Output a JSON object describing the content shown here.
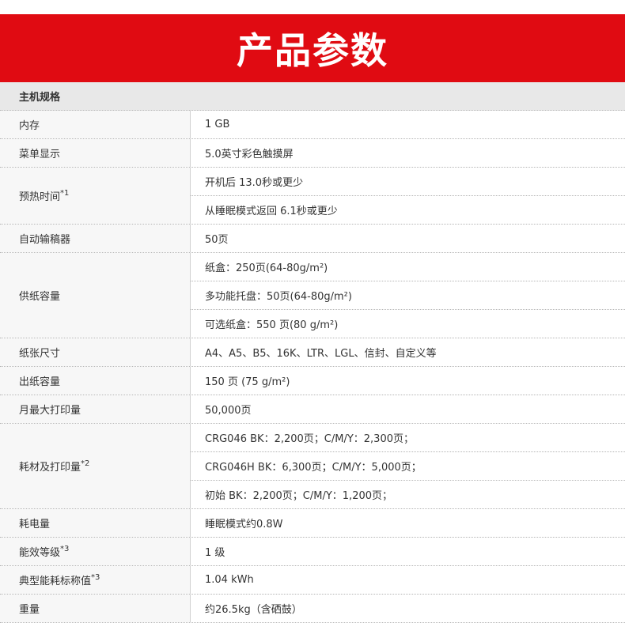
{
  "banner": {
    "title": "产品参数"
  },
  "section": {
    "title": "主机规格"
  },
  "rows": [
    {
      "label": "内存",
      "sup": "",
      "values": [
        "1 GB"
      ]
    },
    {
      "label": "菜单显示",
      "sup": "",
      "values": [
        "5.0英寸彩色触摸屏"
      ]
    },
    {
      "label": "预热时间",
      "sup": "*1",
      "values": [
        "开机后 13.0秒或更少",
        "从睡眠模式返回 6.1秒或更少"
      ]
    },
    {
      "label": "自动输稿器",
      "sup": "",
      "values": [
        "50页"
      ]
    },
    {
      "label": "供纸容量",
      "sup": "",
      "values": [
        "纸盒：250页(64-80g/m²)",
        "多功能托盘：50页(64-80g/m²)",
        "可选纸盒：550 页(80 g/m²)"
      ]
    },
    {
      "label": "纸张尺寸",
      "sup": "",
      "values": [
        "A4、A5、B5、16K、LTR、LGL、信封、自定义等"
      ]
    },
    {
      "label": "出纸容量",
      "sup": "",
      "values": [
        "150 页 (75 g/m²)"
      ]
    },
    {
      "label": "月最大打印量",
      "sup": "",
      "values": [
        "50,000页"
      ]
    },
    {
      "label": "耗材及打印量",
      "sup": "*2",
      "values": [
        "CRG046 BK：2,200页；C/M/Y：2,300页；",
        "CRG046H BK：6,300页；C/M/Y：5,000页；",
        "初始 BK：2,200页；C/M/Y：1,200页；"
      ]
    },
    {
      "label": "耗电量",
      "sup": "",
      "values": [
        "睡眠模式约0.8W"
      ]
    },
    {
      "label": "能效等级",
      "sup": "*3",
      "values": [
        "1 级"
      ]
    },
    {
      "label": "典型能耗标称值",
      "sup": "*3",
      "values": [
        "1.04 kWh"
      ]
    },
    {
      "label": "重量",
      "sup": "",
      "values": [
        "约26.5kg（含硒鼓）"
      ]
    }
  ]
}
